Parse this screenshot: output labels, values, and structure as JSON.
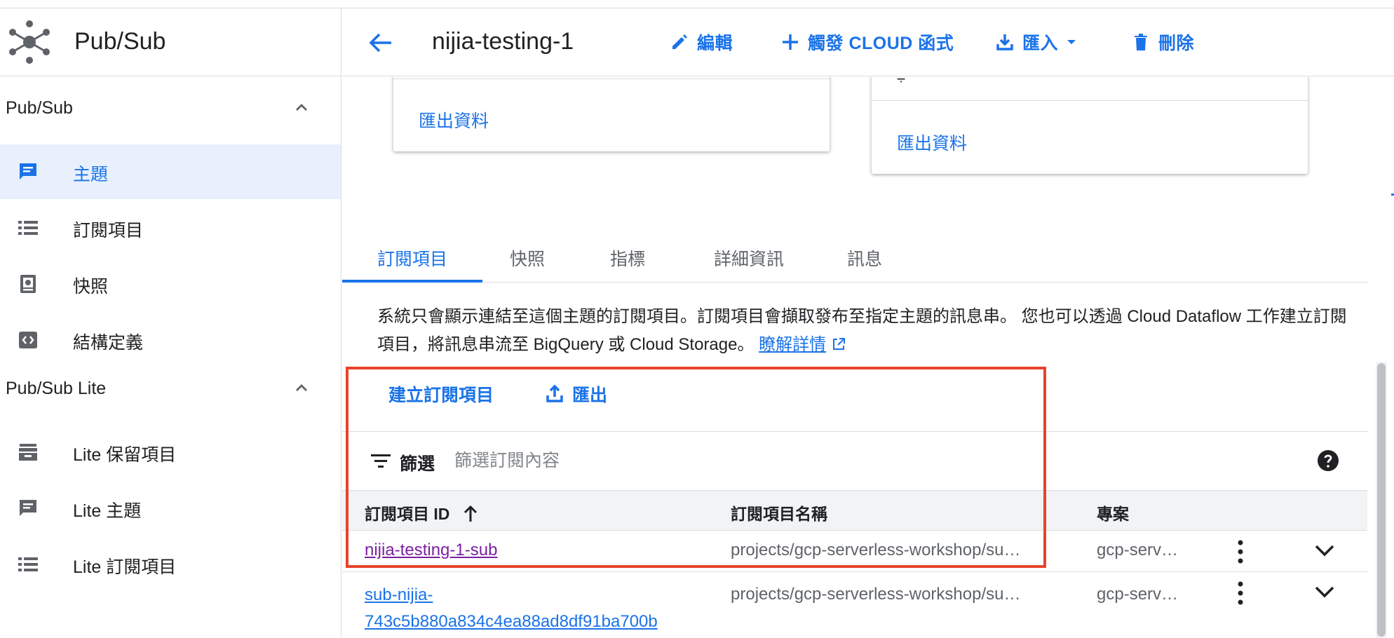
{
  "sidebar": {
    "brand_title": "Pub/Sub",
    "sections": [
      {
        "label": "Pub/Sub",
        "items": [
          {
            "label": "主題",
            "icon": "topic-icon",
            "active": true
          },
          {
            "label": "訂閱項目",
            "icon": "list-icon"
          },
          {
            "label": "快照",
            "icon": "snapshot-icon"
          },
          {
            "label": "結構定義",
            "icon": "schema-icon"
          }
        ]
      },
      {
        "label": "Pub/Sub Lite",
        "items": [
          {
            "label": "Lite 保留項目",
            "icon": "reservation-icon"
          },
          {
            "label": "Lite 主題",
            "icon": "topic-icon"
          },
          {
            "label": "Lite 訂閱項目",
            "icon": "list-icon"
          }
        ]
      }
    ]
  },
  "header": {
    "title": "nijia-testing-1",
    "edit_label": "編輯",
    "trigger_label": "觸發 CLOUD 函式",
    "import_label": "匯入",
    "delete_label": "刪除"
  },
  "cards": {
    "left_export": "匯出資料",
    "right_partial": "÷",
    "right_export": "匯出資料"
  },
  "tabs": [
    "訂閱項目",
    "快照",
    "指標",
    "詳細資訊",
    "訊息"
  ],
  "description": {
    "text": "系統只會顯示連結至這個主題的訂閱項目。訂閱項目會擷取發布至指定主題的訊息串。 您也可以透過 Cloud Dataflow 工作建立訂閱項目，將訊息串流至 BigQuery 或 Cloud Storage。",
    "link": "瞭解詳情"
  },
  "actions": {
    "create_label": "建立訂閱項目",
    "export_label": "匯出"
  },
  "filter": {
    "label": "篩選",
    "placeholder": "篩選訂閱內容"
  },
  "table": {
    "columns": [
      "訂閱項目 ID",
      "訂閱項目名稱",
      "專案"
    ],
    "rows": [
      {
        "id": "nijia-testing-1-sub",
        "name": "projects/gcp-serverless-workshop/su…",
        "project": "gcp-serv…"
      },
      {
        "id_line1": "sub-nijia-",
        "id_line2": "743c5b880a834c4ea88ad8df91ba700b",
        "name": "projects/gcp-serverless-workshop/su…",
        "project": "gcp-serv…"
      }
    ]
  },
  "colors": {
    "accent": "#1a73e8",
    "active_bg": "#e8f0fe",
    "visited_link": "#7b1fa2",
    "highlight": "#e8432c"
  }
}
